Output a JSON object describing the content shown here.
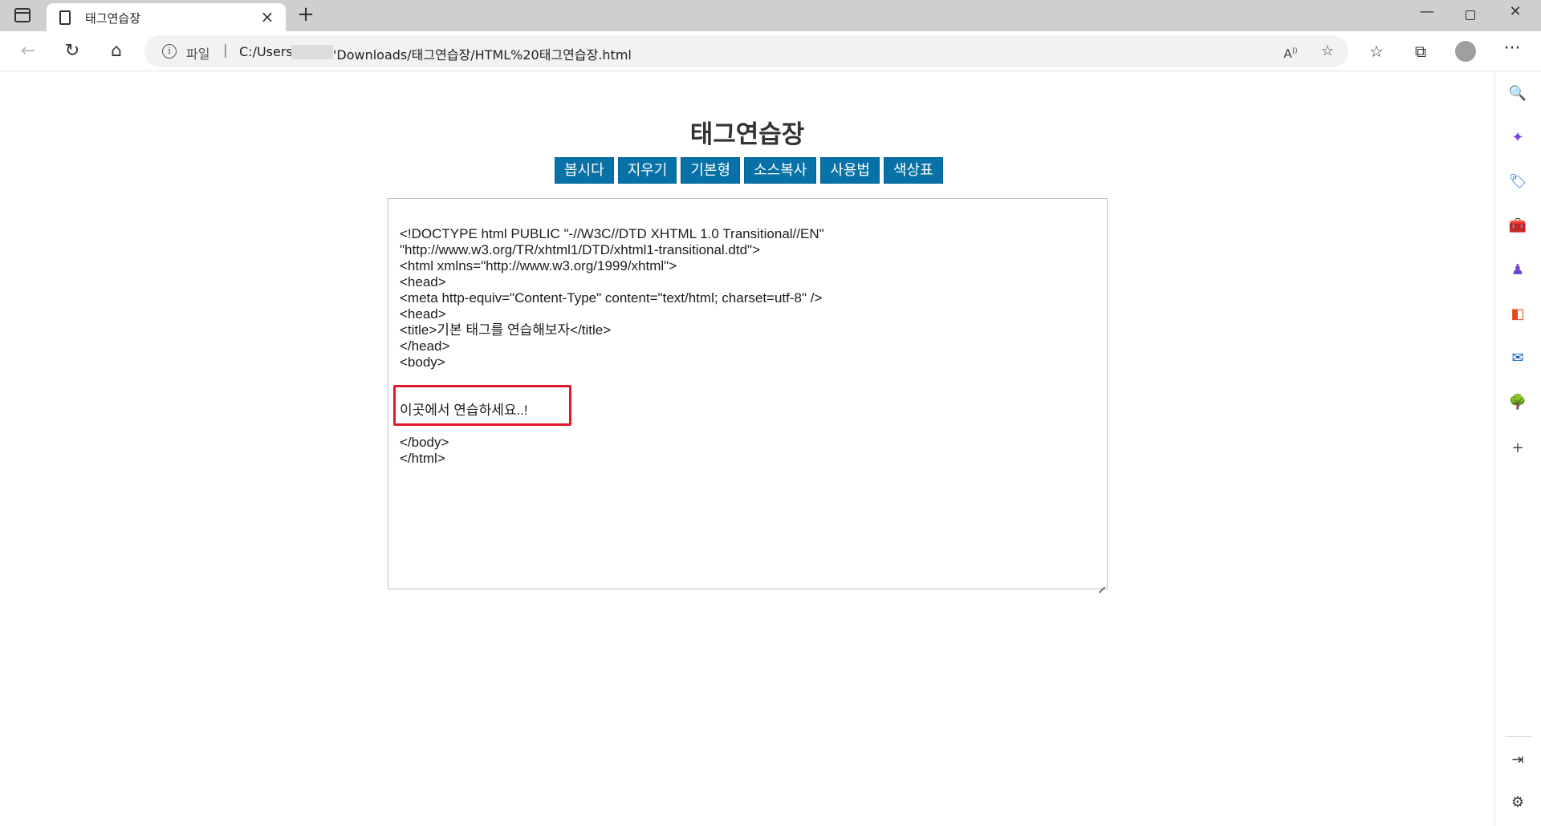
{
  "browser": {
    "tab": {
      "title": "태그연습장"
    },
    "address": {
      "scheme_label": "파일",
      "separator": "|",
      "url_prefix": "C:/Users",
      "url_suffix": "'Downloads/태그연습장/HTML%20태그연습장.html"
    },
    "icons": {
      "tab_actions": "tab-actions-icon",
      "page": "page-icon",
      "close": "close-icon",
      "new_tab": "plus-icon",
      "minimize": "minimize-icon",
      "maximize": "restore-icon",
      "window_close": "close-icon",
      "back": "back-arrow-icon",
      "reload": "reload-icon",
      "home": "home-icon",
      "info": "info-icon",
      "read_aloud": "read-aloud-icon",
      "add_favorite": "add-favorite-icon",
      "favorites": "favorites-icon",
      "collections": "collections-icon",
      "profile": "profile-avatar",
      "more": "more-icon"
    },
    "sidebar": [
      {
        "name": "search-icon",
        "glyph": "🔍",
        "color": "#1a5fd6"
      },
      {
        "name": "copilot-icon",
        "glyph": "✦",
        "color": "#7b3fe4"
      },
      {
        "name": "shopping-tag-icon",
        "glyph": "🏷",
        "color": "#1e6fd9"
      },
      {
        "name": "tools-icon",
        "glyph": "🧰",
        "color": "#1a73e8"
      },
      {
        "name": "games-icon",
        "glyph": "♟",
        "color": "#7043d8"
      },
      {
        "name": "office-icon",
        "glyph": "◧",
        "color": "#e8491d"
      },
      {
        "name": "outlook-icon",
        "glyph": "✉",
        "color": "#0a64c8"
      },
      {
        "name": "tree-icon",
        "glyph": "🌳",
        "color": "#2e8b3a"
      },
      {
        "name": "add-icon",
        "glyph": "+",
        "color": "#444444"
      }
    ],
    "sidebar_bottom": [
      {
        "name": "hide-sidebar-icon",
        "glyph": "⇥",
        "color": "#333333"
      },
      {
        "name": "settings-gear-icon",
        "glyph": "⚙",
        "color": "#333333"
      }
    ]
  },
  "page": {
    "title": "태그연습장",
    "buttons": [
      "봅시다",
      "지우기",
      "기본형",
      "소스복사",
      "사용법",
      "색상표"
    ],
    "editor_lines": [
      "<!DOCTYPE html PUBLIC \"-//W3C//DTD XHTML 1.0 Transitional//EN\"",
      "\"http://www.w3.org/TR/xhtml1/DTD/xhtml1-transitional.dtd\">",
      "<html xmlns=\"http://www.w3.org/1999/xhtml\">",
      "<head>",
      "<meta http-equiv=\"Content-Type\" content=\"text/html; charset=utf-8\" />",
      "<head>",
      "<title>기본 태그를 연습해보자</title>",
      "</head>",
      "<body>",
      "",
      "",
      "이곳에서 연습하세요..!",
      "",
      "</body>",
      "</html>"
    ],
    "highlight_color": "#e2182f",
    "button_color": "#0872a8"
  }
}
